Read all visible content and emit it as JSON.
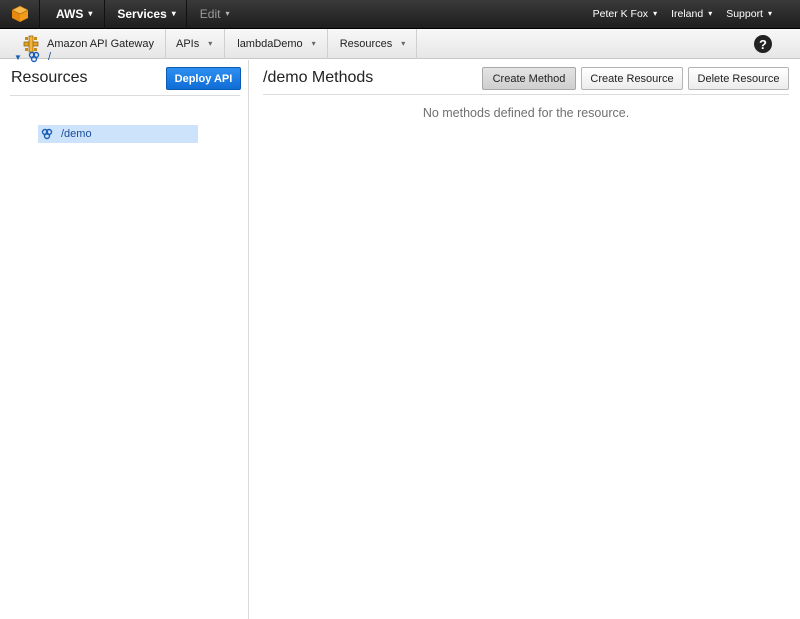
{
  "topnav": {
    "logo_icon": "aws-cube-icon",
    "aws_label": "AWS",
    "services_label": "Services",
    "edit_label": "Edit",
    "user_label": "Peter K Fox",
    "region_label": "Ireland",
    "support_label": "Support",
    "caret_glyph": "▾"
  },
  "subnav": {
    "service_icon": "api-gateway-icon",
    "service_label": "Amazon API Gateway",
    "apis_label": "APIs",
    "api_name_label": "lambdaDemo",
    "resources_label": "Resources",
    "help_glyph": "?"
  },
  "left_panel": {
    "title": "Resources",
    "deploy_button_label": "Deploy API",
    "tree": [
      {
        "path": "/",
        "expanded": true,
        "selected": false
      },
      {
        "path": "/demo",
        "expanded": false,
        "selected": true
      }
    ]
  },
  "main": {
    "title": "/demo Methods",
    "create_method_label": "Create Method",
    "create_resource_label": "Create Resource",
    "delete_resource_label": "Delete Resource",
    "empty_message": "No methods defined for the resource."
  },
  "colors": {
    "topnav_bg": "#232323",
    "accent_blue": "#1577e0",
    "selection_bg": "#cde3fb",
    "aws_orange": "#f19a1b"
  }
}
